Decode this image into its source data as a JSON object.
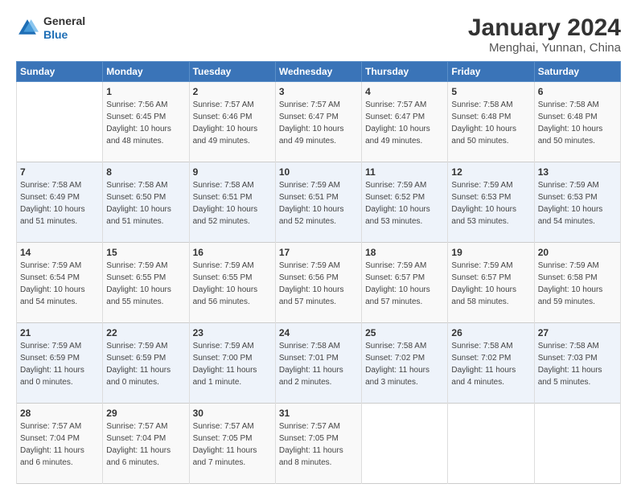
{
  "header": {
    "logo_general": "General",
    "logo_blue": "Blue",
    "title": "January 2024",
    "subtitle": "Menghai, Yunnan, China"
  },
  "columns": [
    "Sunday",
    "Monday",
    "Tuesday",
    "Wednesday",
    "Thursday",
    "Friday",
    "Saturday"
  ],
  "weeks": [
    [
      {
        "day": "",
        "info": ""
      },
      {
        "day": "1",
        "info": "Sunrise: 7:56 AM\nSunset: 6:45 PM\nDaylight: 10 hours\nand 48 minutes."
      },
      {
        "day": "2",
        "info": "Sunrise: 7:57 AM\nSunset: 6:46 PM\nDaylight: 10 hours\nand 49 minutes."
      },
      {
        "day": "3",
        "info": "Sunrise: 7:57 AM\nSunset: 6:47 PM\nDaylight: 10 hours\nand 49 minutes."
      },
      {
        "day": "4",
        "info": "Sunrise: 7:57 AM\nSunset: 6:47 PM\nDaylight: 10 hours\nand 49 minutes."
      },
      {
        "day": "5",
        "info": "Sunrise: 7:58 AM\nSunset: 6:48 PM\nDaylight: 10 hours\nand 50 minutes."
      },
      {
        "day": "6",
        "info": "Sunrise: 7:58 AM\nSunset: 6:48 PM\nDaylight: 10 hours\nand 50 minutes."
      }
    ],
    [
      {
        "day": "7",
        "info": "Sunrise: 7:58 AM\nSunset: 6:49 PM\nDaylight: 10 hours\nand 51 minutes."
      },
      {
        "day": "8",
        "info": "Sunrise: 7:58 AM\nSunset: 6:50 PM\nDaylight: 10 hours\nand 51 minutes."
      },
      {
        "day": "9",
        "info": "Sunrise: 7:58 AM\nSunset: 6:51 PM\nDaylight: 10 hours\nand 52 minutes."
      },
      {
        "day": "10",
        "info": "Sunrise: 7:59 AM\nSunset: 6:51 PM\nDaylight: 10 hours\nand 52 minutes."
      },
      {
        "day": "11",
        "info": "Sunrise: 7:59 AM\nSunset: 6:52 PM\nDaylight: 10 hours\nand 53 minutes."
      },
      {
        "day": "12",
        "info": "Sunrise: 7:59 AM\nSunset: 6:53 PM\nDaylight: 10 hours\nand 53 minutes."
      },
      {
        "day": "13",
        "info": "Sunrise: 7:59 AM\nSunset: 6:53 PM\nDaylight: 10 hours\nand 54 minutes."
      }
    ],
    [
      {
        "day": "14",
        "info": "Sunrise: 7:59 AM\nSunset: 6:54 PM\nDaylight: 10 hours\nand 54 minutes."
      },
      {
        "day": "15",
        "info": "Sunrise: 7:59 AM\nSunset: 6:55 PM\nDaylight: 10 hours\nand 55 minutes."
      },
      {
        "day": "16",
        "info": "Sunrise: 7:59 AM\nSunset: 6:55 PM\nDaylight: 10 hours\nand 56 minutes."
      },
      {
        "day": "17",
        "info": "Sunrise: 7:59 AM\nSunset: 6:56 PM\nDaylight: 10 hours\nand 57 minutes."
      },
      {
        "day": "18",
        "info": "Sunrise: 7:59 AM\nSunset: 6:57 PM\nDaylight: 10 hours\nand 57 minutes."
      },
      {
        "day": "19",
        "info": "Sunrise: 7:59 AM\nSunset: 6:57 PM\nDaylight: 10 hours\nand 58 minutes."
      },
      {
        "day": "20",
        "info": "Sunrise: 7:59 AM\nSunset: 6:58 PM\nDaylight: 10 hours\nand 59 minutes."
      }
    ],
    [
      {
        "day": "21",
        "info": "Sunrise: 7:59 AM\nSunset: 6:59 PM\nDaylight: 11 hours\nand 0 minutes."
      },
      {
        "day": "22",
        "info": "Sunrise: 7:59 AM\nSunset: 6:59 PM\nDaylight: 11 hours\nand 0 minutes."
      },
      {
        "day": "23",
        "info": "Sunrise: 7:59 AM\nSunset: 7:00 PM\nDaylight: 11 hours\nand 1 minute."
      },
      {
        "day": "24",
        "info": "Sunrise: 7:58 AM\nSunset: 7:01 PM\nDaylight: 11 hours\nand 2 minutes."
      },
      {
        "day": "25",
        "info": "Sunrise: 7:58 AM\nSunset: 7:02 PM\nDaylight: 11 hours\nand 3 minutes."
      },
      {
        "day": "26",
        "info": "Sunrise: 7:58 AM\nSunset: 7:02 PM\nDaylight: 11 hours\nand 4 minutes."
      },
      {
        "day": "27",
        "info": "Sunrise: 7:58 AM\nSunset: 7:03 PM\nDaylight: 11 hours\nand 5 minutes."
      }
    ],
    [
      {
        "day": "28",
        "info": "Sunrise: 7:57 AM\nSunset: 7:04 PM\nDaylight: 11 hours\nand 6 minutes."
      },
      {
        "day": "29",
        "info": "Sunrise: 7:57 AM\nSunset: 7:04 PM\nDaylight: 11 hours\nand 6 minutes."
      },
      {
        "day": "30",
        "info": "Sunrise: 7:57 AM\nSunset: 7:05 PM\nDaylight: 11 hours\nand 7 minutes."
      },
      {
        "day": "31",
        "info": "Sunrise: 7:57 AM\nSunset: 7:05 PM\nDaylight: 11 hours\nand 8 minutes."
      },
      {
        "day": "",
        "info": ""
      },
      {
        "day": "",
        "info": ""
      },
      {
        "day": "",
        "info": ""
      }
    ]
  ]
}
